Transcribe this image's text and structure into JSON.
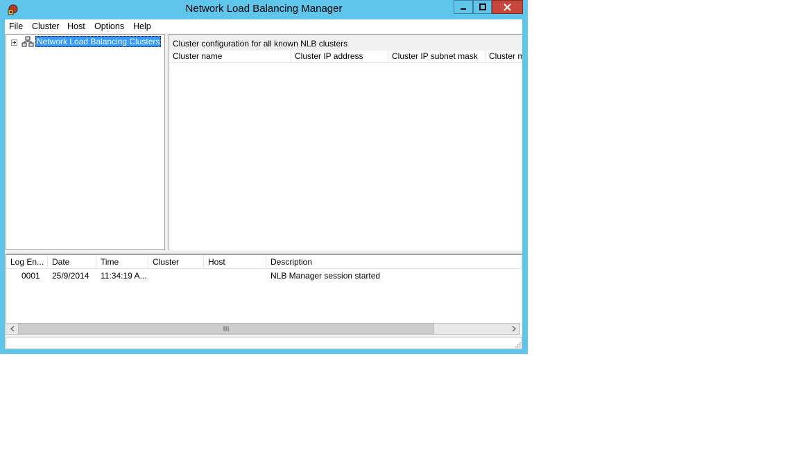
{
  "window": {
    "title": "Network Load Balancing Manager"
  },
  "controls": {
    "minimize": "minimize",
    "maximize": "maximize",
    "close": "close"
  },
  "menu": [
    "File",
    "Cluster",
    "Host",
    "Options",
    "Help"
  ],
  "tree": {
    "root_label": "Network Load Balancing Clusters"
  },
  "details": {
    "header": "Cluster configuration for all known NLB clusters",
    "columns": [
      "Cluster name",
      "Cluster IP address",
      "Cluster IP subnet mask",
      "Cluster mo"
    ]
  },
  "log": {
    "columns": [
      "Log En...",
      "Date",
      "Time",
      "Cluster",
      "Host",
      "Description"
    ],
    "rows": [
      {
        "entry": "0001",
        "date": "25/9/2014",
        "time": "11:34:19 A...",
        "cluster": "",
        "host": "",
        "description": "NLB Manager session started"
      }
    ]
  },
  "colors": {
    "frame": "#5fc5ea",
    "close": "#c7463c",
    "selection": "#3399ff"
  }
}
